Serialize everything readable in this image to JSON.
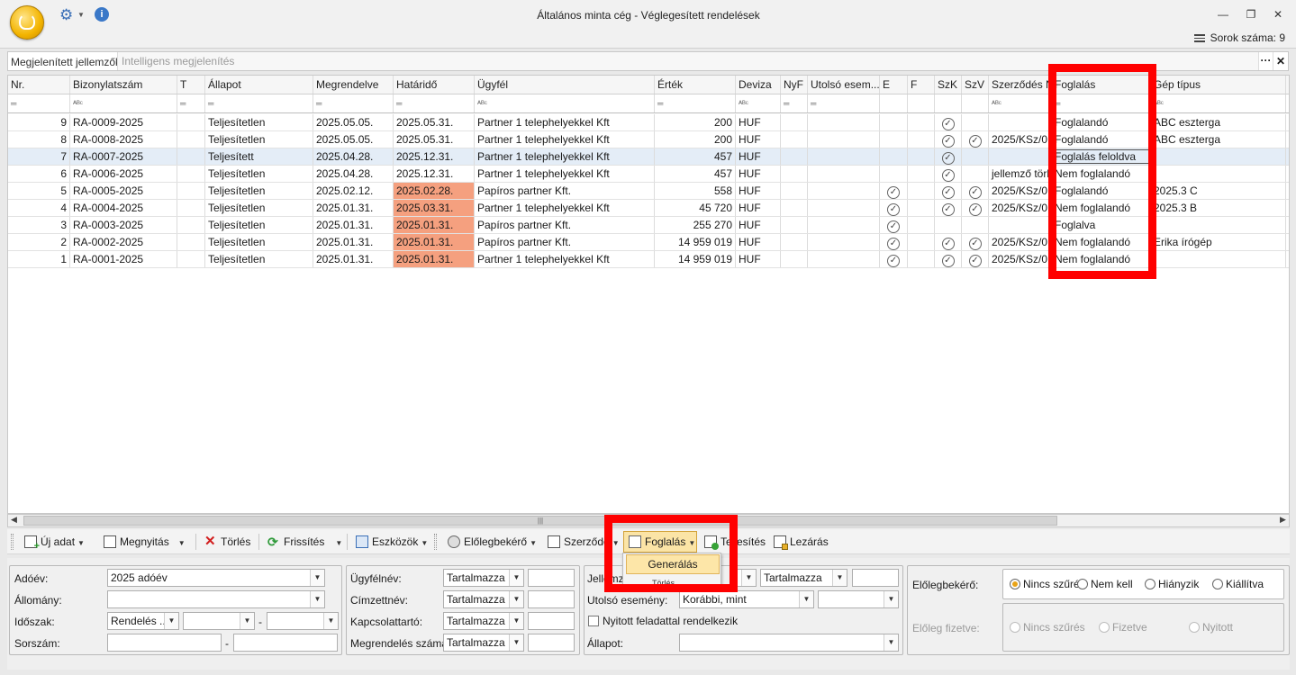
{
  "window": {
    "title": "Általános minta cég - Véglegesített rendelések",
    "row_count": "Sorok száma: 9",
    "minimize_glyph": "—",
    "restore_glyph": "❐",
    "close_glyph": "✕"
  },
  "toolbar_top": {
    "gear_icon": "⚙",
    "info_icon": "i"
  },
  "properties": {
    "label": "Megjelenített jellemzők:",
    "value": "Intelligens megjelenítés",
    "more": "···",
    "clear": "✕"
  },
  "grid": {
    "columns": [
      "Nr.",
      "Bizonylatszám",
      "T",
      "Állapot",
      "Megrendelve",
      "Határidő",
      "Ügyfél",
      "Érték",
      "Deviza",
      "NyF",
      "Utolsó esem...",
      "E",
      "F",
      "SzK",
      "SzV",
      "Szerződés Nr",
      "Foglalás",
      "Gép típus"
    ],
    "filters": [
      "═",
      "ᴬᴮᶜ",
      "═",
      "═",
      "═",
      "═",
      "ᴬᴮᶜ",
      "═",
      "ᴬᴮᶜ",
      "═",
      "═",
      "",
      "",
      "",
      "",
      "ᴬᴮᶜ",
      "═",
      "ᴬᴮᶜ"
    ],
    "rows": [
      {
        "nr": "9",
        "biz": "RA-0009-2025",
        "allapot": "Teljesítetlen",
        "megr": "2025.05.05.",
        "hat": "2025.05.31.",
        "ugyfel": "Partner 1 telephelyekkel Kft",
        "ertek": "200",
        "deviza": "HUF",
        "e": false,
        "szk": true,
        "szv": false,
        "szerz": "",
        "fogl": "Foglalandó",
        "gep": "ABC eszterga",
        "overdue": false,
        "selected": false
      },
      {
        "nr": "8",
        "biz": "RA-0008-2025",
        "allapot": "Teljesítetlen",
        "megr": "2025.05.05.",
        "hat": "2025.05.31.",
        "ugyfel": "Partner 1 telephelyekkel Kft",
        "ertek": "200",
        "deviza": "HUF",
        "e": false,
        "szk": true,
        "szv": true,
        "szerz": "2025/KSz/0...",
        "fogl": "Foglalandó",
        "gep": "ABC eszterga",
        "overdue": false,
        "selected": false
      },
      {
        "nr": "7",
        "biz": "RA-0007-2025",
        "allapot": "Teljesített",
        "megr": "2025.04.28.",
        "hat": "2025.12.31.",
        "ugyfel": "Partner 1 telephelyekkel Kft",
        "ertek": "457",
        "deviza": "HUF",
        "e": false,
        "szk": true,
        "szv": false,
        "szerz": "",
        "fogl": "Foglalás feloldva",
        "gep": "",
        "overdue": false,
        "selected": true
      },
      {
        "nr": "6",
        "biz": "RA-0006-2025",
        "allapot": "Teljesítetlen",
        "megr": "2025.04.28.",
        "hat": "2025.12.31.",
        "ugyfel": "Partner 1 telephelyekkel Kft",
        "ertek": "457",
        "deviza": "HUF",
        "e": false,
        "szk": true,
        "szv": false,
        "szerz": "jellemző törl...",
        "fogl": "Nem foglalandó",
        "gep": "",
        "overdue": false,
        "selected": false
      },
      {
        "nr": "5",
        "biz": "RA-0005-2025",
        "allapot": "Teljesítetlen",
        "megr": "2025.02.12.",
        "hat": "2025.02.28.",
        "ugyfel": "Papíros partner Kft.",
        "ertek": "558",
        "deviza": "HUF",
        "e": true,
        "szk": true,
        "szv": true,
        "szerz": "2025/KSz/0...",
        "fogl": "Foglalandó",
        "gep": "2025.3 C",
        "overdue": true,
        "selected": false
      },
      {
        "nr": "4",
        "biz": "RA-0004-2025",
        "allapot": "Teljesítetlen",
        "megr": "2025.01.31.",
        "hat": "2025.03.31.",
        "ugyfel": "Partner 1 telephelyekkel Kft",
        "ertek": "45 720",
        "deviza": "HUF",
        "e": true,
        "szk": true,
        "szv": true,
        "szerz": "2025/KSz/0...",
        "fogl": "Nem foglalandó",
        "gep": "2025.3 B",
        "overdue": true,
        "selected": false
      },
      {
        "nr": "3",
        "biz": "RA-0003-2025",
        "allapot": "Teljesítetlen",
        "megr": "2025.01.31.",
        "hat": "2025.01.31.",
        "ugyfel": "Papíros partner Kft.",
        "ertek": "255 270",
        "deviza": "HUF",
        "e": true,
        "szk": false,
        "szv": false,
        "szerz": "",
        "fogl": "Foglalva",
        "gep": "",
        "overdue": true,
        "selected": false
      },
      {
        "nr": "2",
        "biz": "RA-0002-2025",
        "allapot": "Teljesítetlen",
        "megr": "2025.01.31.",
        "hat": "2025.01.31.",
        "ugyfel": "Papíros partner Kft.",
        "ertek": "14 959 019",
        "deviza": "HUF",
        "e": true,
        "szk": true,
        "szv": true,
        "szerz": "2025/KSz/0...",
        "fogl": "Nem foglalandó",
        "gep": "Erika írógép",
        "overdue": true,
        "selected": false
      },
      {
        "nr": "1",
        "biz": "RA-0001-2025",
        "allapot": "Teljesítetlen",
        "megr": "2025.01.31.",
        "hat": "2025.01.31.",
        "ugyfel": "Partner 1 telephelyekkel Kft",
        "ertek": "14 959 019",
        "deviza": "HUF",
        "e": true,
        "szk": true,
        "szv": true,
        "szerz": "2025/KSz/0...",
        "fogl": "Nem foglalandó",
        "gep": "",
        "overdue": true,
        "selected": false
      }
    ],
    "check_glyph": "✓"
  },
  "toolbar": {
    "new": "Új adat",
    "open": "Megnyitás",
    "delete": "Törlés",
    "refresh": "Frissítés",
    "tools": "Eszközök",
    "prepay": "Előlegbekérő",
    "contract": "Szerződé",
    "booking": "Foglalás",
    "fulfil": "Teljesítés",
    "close": "Lezárás",
    "menu_generate": "Generálás",
    "menu_under": "Törlés"
  },
  "filters": {
    "adoev_label": "Adóév:",
    "adoev_value": "2025 adóév",
    "allomany_label": "Állomány:",
    "idoszak_label": "Időszak:",
    "idoszak_value": "Rendelés ...",
    "dash": "-",
    "sorszam_label": "Sorszám:",
    "ugyfelnev_label": "Ügyfélnév:",
    "cimzett_label": "Címzettnév:",
    "kapcs_label": "Kapcsolattartó:",
    "megrszam_label": "Megrendelés száma:",
    "contains": "Tartalmazza",
    "jell_label": "Jellemző:",
    "utolso_label": "Utolsó esemény:",
    "utolso_value": "Korábbi, mint",
    "nyitott_label": "Nyitott feladattal rendelkezik",
    "allapot_label": "Állapot:",
    "elolegbekero_label": "Előlegbekérő:",
    "opt_nincs": "Nincs szűrés",
    "opt_nemkell": "Nem kell",
    "opt_hianyzik": "Hiányzik",
    "opt_kiallitva": "Kiállítva",
    "eloleg_fizetve_label": "Előleg fizetve:",
    "opt_fizetve": "Fizetve",
    "opt_nyitott": "Nyitott",
    "dd_glyph": "▼"
  },
  "colors": {
    "highlight": "#ff0000",
    "overdue": "#f5a07f",
    "accent": "#fbe4a6"
  }
}
